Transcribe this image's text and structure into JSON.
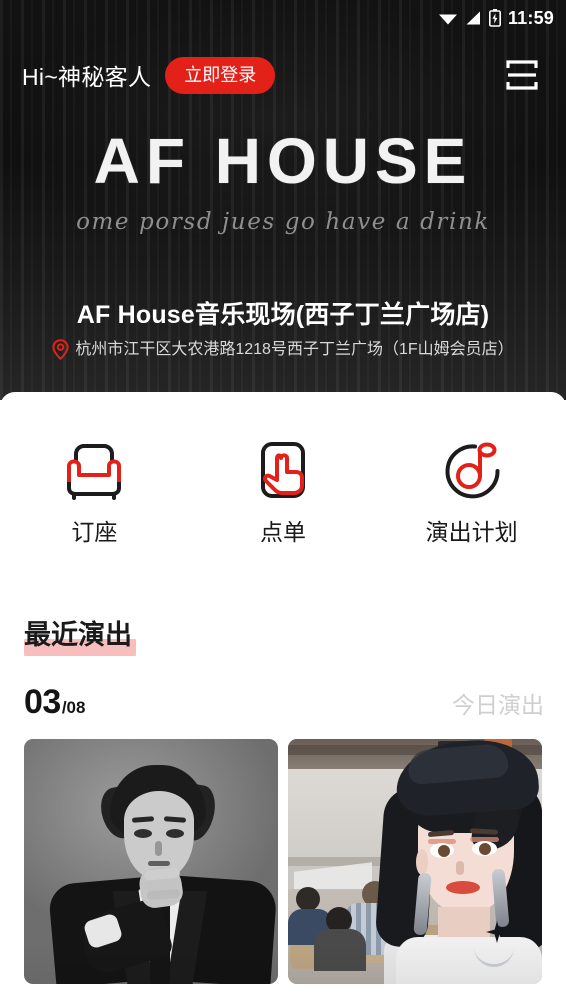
{
  "status_bar": {
    "time": "11:59",
    "icons": [
      "wifi-icon",
      "cellular-signal-icon",
      "battery-charging-icon"
    ]
  },
  "top_nav": {
    "greeting": "Hi~神秘客人",
    "login_label": "立即登录",
    "menu_icon": "hamburger-menu-icon"
  },
  "hero": {
    "logo_text": "AF HOUSE",
    "tagline": "ome porsd jues go have a drink",
    "venue_name": "AF House音乐现场(西子丁兰广场店)",
    "venue_address": "杭州市江干区大农港路1218号西子丁兰广场（1F山姆会员店）",
    "location_icon": "location-pin-icon"
  },
  "quick_actions": [
    {
      "label": "订座",
      "icon": "sofa-seat-icon"
    },
    {
      "label": "点单",
      "icon": "hand-tap-menu-icon"
    },
    {
      "label": "演出计划",
      "icon": "music-note-circle-icon"
    }
  ],
  "recent_section": {
    "heading": "最近演出",
    "date_main": "03",
    "date_sub": "/08",
    "today_label": "今日演出"
  },
  "performance_cards": [
    {
      "name": "performer-photo-1",
      "alt": "黑白人像 西装青年"
    },
    {
      "name": "performer-photo-2",
      "alt": "彩色自拍 贝雷帽女孩"
    }
  ],
  "colors": {
    "accent_red": "#e32119",
    "highlight_pink": "#f7b3b3",
    "hero_dark": "#121212",
    "muted_gray": "#cfcfcf"
  }
}
